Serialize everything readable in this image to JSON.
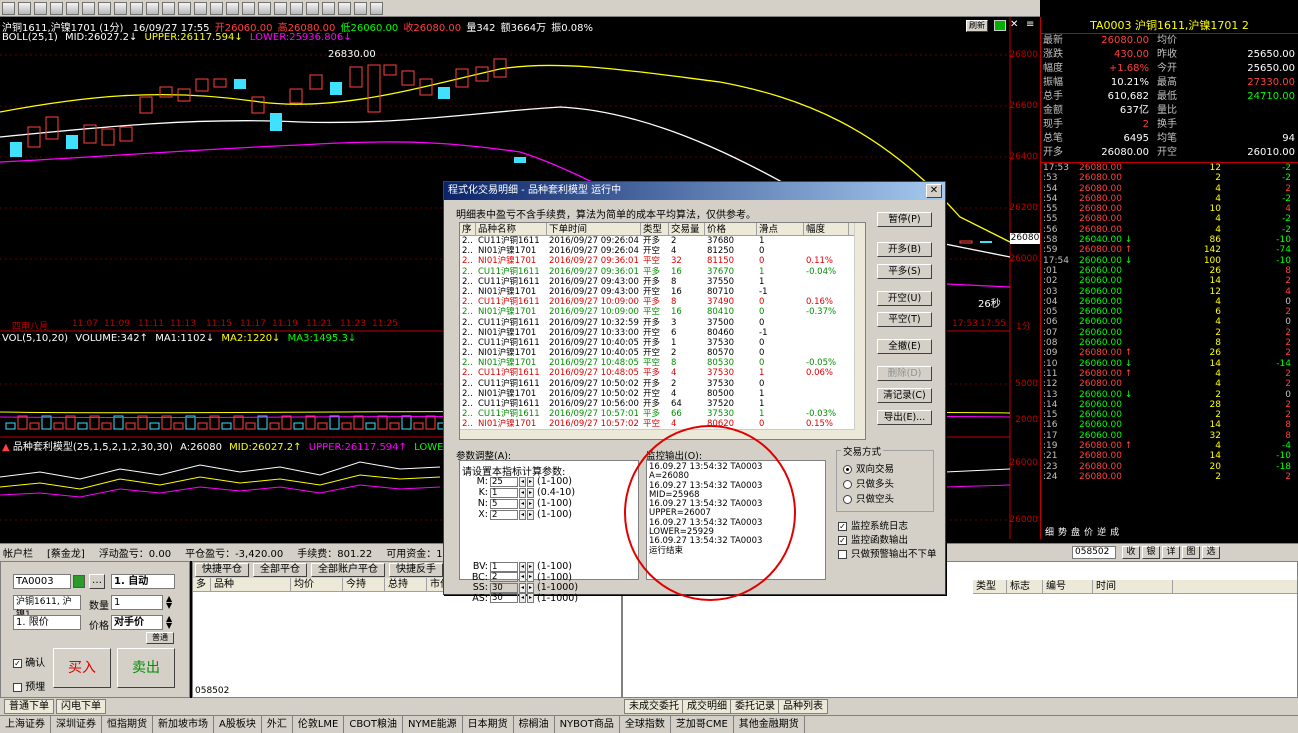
{
  "chart": {
    "header": [
      "沪铜1611,沪镍1701 (1分)",
      "16/09/27 17:55",
      "开26060.00",
      "高26080.00",
      "低26060.00",
      "收26080.00",
      "量342",
      "额3664万",
      "振0.08%"
    ],
    "boll": {
      "label": "BOLL(25,1)",
      "mid": "MID:26027.2↓",
      "upper": "UPPER:26117.594↓",
      "lower": "LOWER:25936.806↓"
    },
    "peak_label": "26830.00",
    "refresh_btn": "刷新",
    "axis_right": [
      "26800",
      "26600",
      "26400",
      "26200",
      "26000"
    ],
    "price_tag": "26080",
    "countdown": "26秒",
    "time_axis": [
      "四审八月",
      "11:07",
      "11:09",
      "11:11",
      "11:13",
      "11:15",
      "11:17",
      "11:19",
      "11:21",
      "11:23",
      "11:25",
      "17:53",
      "17:55",
      "1分"
    ],
    "vol": {
      "label": "VOL(5,10,20)",
      "volume": "VOLUME:342↑",
      "ma1": "MA1:1102↓",
      "ma2": "MA2:1220↓",
      "ma3": "MA3:1495.3↓"
    },
    "vol_axis": [
      "5000",
      "2000"
    ],
    "model": {
      "label": "品种套利模型(25,1,5,2,1,2,30,30)",
      "a": "A:26080",
      "mid": "MID:26027.2↑",
      "upper": "UPPER:26117.594↑",
      "lower": "LOWER:25936.806↑"
    },
    "model_axis": [
      "26000",
      "26000"
    ]
  },
  "quote": {
    "title": "TA0003  沪铜1611,沪镍1701  2",
    "rows": [
      {
        "l": "最新",
        "v": "26080.00",
        "vc": "#ff4040",
        "l2": "均价",
        "v2": "",
        "v2c": "#c0c0c0"
      },
      {
        "l": "涨跌",
        "v": "430.00",
        "vc": "#ff4040",
        "l2": "昨收",
        "v2": "25650.00",
        "v2c": "#ffffff"
      },
      {
        "l": "幅度",
        "v": "+1.68%",
        "vc": "#ff4040",
        "l2": "今开",
        "v2": "25650.00",
        "v2c": "#ffffff"
      },
      {
        "l": "振幅",
        "v": "10.21%",
        "vc": "#ffffff",
        "l2": "最高",
        "v2": "27330.00",
        "v2c": "#ff4040"
      },
      {
        "l": "总手",
        "v": "610,682",
        "vc": "#ffffff",
        "l2": "最低",
        "v2": "24710.00",
        "v2c": "#00ff00"
      },
      {
        "l": "金额",
        "v": "637亿",
        "vc": "#ffffff",
        "l2": "量比",
        "v2": "",
        "v2c": "#c0c0c0"
      },
      {
        "l": "现手",
        "v": "2",
        "vc": "#ff4040",
        "l2": "换手",
        "v2": "",
        "v2c": "#c0c0c0"
      },
      {
        "l": "总笔",
        "v": "6495",
        "vc": "#ffffff",
        "l2": "均笔",
        "v2": "94",
        "v2c": "#ffffff"
      },
      {
        "l": "开多",
        "v": "26080.00",
        "vc": "#ffffff",
        "l2": "开空",
        "v2": "26010.00",
        "v2c": "#ffffff"
      }
    ],
    "ticks": [
      {
        "t": "17:53",
        "p": "26080.00",
        "vol": "12",
        "chg": "-2",
        "vc": "#ff4040",
        "cc": "#00ff00"
      },
      {
        "t": ":53",
        "p": "26080.00",
        "vol": "2",
        "chg": "-2",
        "vc": "#ff4040",
        "cc": "#00ff00"
      },
      {
        "t": ":54",
        "p": "26080.00",
        "vol": "4",
        "chg": "2",
        "vc": "#ff4040",
        "cc": "#ff4040"
      },
      {
        "t": ":54",
        "p": "26080.00",
        "vol": "4",
        "chg": "-2",
        "vc": "#ff4040",
        "cc": "#00ff00"
      },
      {
        "t": ":55",
        "p": "26080.00",
        "vol": "10",
        "chg": "4",
        "vc": "#ff4040",
        "cc": "#ff4040"
      },
      {
        "t": ":55",
        "p": "26080.00",
        "vol": "4",
        "chg": "-2",
        "vc": "#ff4040",
        "cc": "#00ff00"
      },
      {
        "t": ":56",
        "p": "26080.00",
        "vol": "4",
        "chg": "-2",
        "vc": "#ff4040",
        "cc": "#00ff00"
      },
      {
        "t": ":58",
        "p": "26040.00 ↓",
        "vol": "86",
        "chg": "-10",
        "vc": "#00ff00",
        "cc": "#00ff00"
      },
      {
        "t": ":59",
        "p": "26080.00 ↑",
        "vol": "142",
        "chg": "-74",
        "vc": "#ff4040",
        "cc": "#00ff00"
      },
      {
        "t": "17:54",
        "p": "26060.00 ↓",
        "vol": "100",
        "chg": "-10",
        "vc": "#00ff00",
        "cc": "#00ff00"
      },
      {
        "t": ":01",
        "p": "26060.00",
        "vol": "26",
        "chg": "8",
        "vc": "#00ff00",
        "cc": "#ff4040"
      },
      {
        "t": ":02",
        "p": "26060.00",
        "vol": "14",
        "chg": "2",
        "vc": "#00ff00",
        "cc": "#ff4040"
      },
      {
        "t": ":03",
        "p": "26060.00",
        "vol": "12",
        "chg": "4",
        "vc": "#00ff00",
        "cc": "#ff4040"
      },
      {
        "t": ":04",
        "p": "26060.00",
        "vol": "4",
        "chg": "0",
        "vc": "#00ff00",
        "cc": "#c0c0c0"
      },
      {
        "t": ":05",
        "p": "26060.00",
        "vol": "6",
        "chg": "2",
        "vc": "#00ff00",
        "cc": "#ff4040"
      },
      {
        "t": ":06",
        "p": "26060.00",
        "vol": "4",
        "chg": "0",
        "vc": "#00ff00",
        "cc": "#c0c0c0"
      },
      {
        "t": ":07",
        "p": "26060.00",
        "vol": "2",
        "chg": "2",
        "vc": "#00ff00",
        "cc": "#ff4040"
      },
      {
        "t": ":08",
        "p": "26060.00",
        "vol": "8",
        "chg": "2",
        "vc": "#00ff00",
        "cc": "#ff4040"
      },
      {
        "t": ":09",
        "p": "26080.00 ↑",
        "vol": "26",
        "chg": "2",
        "vc": "#ff4040",
        "cc": "#ff4040"
      },
      {
        "t": ":10",
        "p": "26060.00 ↓",
        "vol": "14",
        "chg": "-14",
        "vc": "#00ff00",
        "cc": "#00ff00"
      },
      {
        "t": ":11",
        "p": "26080.00 ↑",
        "vol": "4",
        "chg": "2",
        "vc": "#ff4040",
        "cc": "#ff4040"
      },
      {
        "t": ":12",
        "p": "26080.00",
        "vol": "4",
        "chg": "2",
        "vc": "#ff4040",
        "cc": "#ff4040"
      },
      {
        "t": ":13",
        "p": "26060.00 ↓",
        "vol": "2",
        "chg": "0",
        "vc": "#00ff00",
        "cc": "#c0c0c0"
      },
      {
        "t": ":14",
        "p": "26060.00",
        "vol": "28",
        "chg": "2",
        "vc": "#00ff00",
        "cc": "#ff4040"
      },
      {
        "t": ":15",
        "p": "26060.00",
        "vol": "2",
        "chg": "2",
        "vc": "#00ff00",
        "cc": "#ff4040"
      },
      {
        "t": ":16",
        "p": "26060.00",
        "vol": "14",
        "chg": "8",
        "vc": "#00ff00",
        "cc": "#ff4040"
      },
      {
        "t": ":17",
        "p": "26060.00",
        "vol": "32",
        "chg": "8",
        "vc": "#00ff00",
        "cc": "#ff4040"
      },
      {
        "t": ":19",
        "p": "26080.00 ↑",
        "vol": "4",
        "chg": "-4",
        "vc": "#ff4040",
        "cc": "#00ff00"
      },
      {
        "t": ":21",
        "p": "26080.00",
        "vol": "14",
        "chg": "-10",
        "vc": "#ff4040",
        "cc": "#00ff00"
      },
      {
        "t": ":23",
        "p": "26080.00",
        "vol": "20",
        "chg": "-18",
        "vc": "#ff4040",
        "cc": "#00ff00"
      },
      {
        "t": ":24",
        "p": "26080.00",
        "vol": "2",
        "chg": "2",
        "vc": "#ff4040",
        "cc": "#ff4040"
      }
    ],
    "tabs": [
      "细",
      "势",
      "盘",
      "价",
      "逆",
      "成"
    ]
  },
  "account": {
    "label": "帐户栏",
    "name": "[蔡金龙]",
    "float_pnl": "浮动盈亏：0.00",
    "close_pnl": "平仓盈亏：-3,420.00",
    "fee": "手续费：801.22",
    "available": "可用资金：1,110,091.73",
    "account_id": "058502",
    "right_btns": [
      "收",
      "银",
      "详",
      "图",
      "选"
    ]
  },
  "order": {
    "code": "TA0003",
    "mode": "1. 自动",
    "name": "沪铜1611, 沪镍1",
    "qty_label": "数量",
    "qty": "1",
    "price_type": "1. 限价",
    "price_label": "价格",
    "price": "对手价",
    "refresh": "普通",
    "confirm_label": "确认",
    "preorder_label": "预埋",
    "buy_label": "买入",
    "sell_label": "卖出"
  },
  "positions": {
    "buttons": [
      "快捷平仓",
      "全部平仓",
      "全部账户平仓",
      "快捷反手"
    ],
    "columns": [
      "多",
      "品种",
      "均价",
      "今持",
      "总持",
      "市价"
    ],
    "footer": "058502"
  },
  "deals": {
    "columns": [
      "类型",
      "标志",
      "编号",
      "时间"
    ]
  },
  "bottom_tabs_left": [
    "普通下单",
    "闪电下单"
  ],
  "bottom_tabs_right": [
    "未成交委托",
    "成交明细",
    "委托记录",
    "品种列表"
  ],
  "markets": [
    "上海证券",
    "深圳证券",
    "恒指期货",
    "新加坡市场",
    "A股板块",
    "外汇",
    "伦敦LME",
    "CBOT粮油",
    "NYME能源",
    "日本期货",
    "棕榈油",
    "NYBOT商品",
    "全球指数",
    "芝加哥CME",
    "其他金融期货"
  ],
  "dialog": {
    "title": "程式化交易明细 - 品种套利模型 运行中",
    "note": "明细表中盈亏不含手续费，算法为简单的成本平均算法，仅供参考。",
    "columns": [
      "序",
      "品种名称",
      "下单时间",
      "类型",
      "交易量",
      "价格",
      "滑点",
      "幅度"
    ],
    "rows": [
      {
        "c": "r-black",
        "v": [
          "2..",
          "CU11沪铜1611",
          "2016/09/27 09:26:04",
          "开多",
          "2",
          "37680",
          "1",
          ""
        ]
      },
      {
        "c": "r-black",
        "v": [
          "2..",
          "NI01沪镍1701",
          "2016/09/27 09:26:04",
          "开空",
          "4",
          "81250",
          "0",
          ""
        ]
      },
      {
        "c": "r-red",
        "v": [
          "2..",
          "NI01沪镍1701",
          "2016/09/27 09:36:01",
          "平空",
          "32",
          "81150",
          "0",
          "0.11%"
        ]
      },
      {
        "c": "r-green",
        "v": [
          "2..",
          "CU11沪铜1611",
          "2016/09/27 09:36:01",
          "平多",
          "16",
          "37670",
          "1",
          "-0.04%"
        ]
      },
      {
        "c": "r-black",
        "v": [
          "2..",
          "CU11沪铜1611",
          "2016/09/27 09:43:00",
          "开多",
          "8",
          "37550",
          "1",
          ""
        ]
      },
      {
        "c": "r-black",
        "v": [
          "2..",
          "NI01沪镍1701",
          "2016/09/27 09:43:00",
          "开空",
          "16",
          "80710",
          "-1",
          ""
        ]
      },
      {
        "c": "r-red",
        "v": [
          "2..",
          "CU11沪铜1611",
          "2016/09/27 10:09:00",
          "平多",
          "8",
          "37490",
          "0",
          "0.16%"
        ]
      },
      {
        "c": "r-green",
        "v": [
          "2..",
          "NI01沪镍1701",
          "2016/09/27 10:09:00",
          "平空",
          "16",
          "80410",
          "0",
          "-0.37%"
        ]
      },
      {
        "c": "r-black",
        "v": [
          "2..",
          "CU11沪铜1611",
          "2016/09/27 10:32:59",
          "开多",
          "3",
          "37500",
          "0",
          ""
        ]
      },
      {
        "c": "r-black",
        "v": [
          "2..",
          "NI01沪镍1701",
          "2016/09/27 10:33:00",
          "开空",
          "6",
          "80460",
          "-1",
          ""
        ]
      },
      {
        "c": "r-black",
        "v": [
          "2..",
          "CU11沪铜1611",
          "2016/09/27 10:40:05",
          "开多",
          "1",
          "37530",
          "0",
          ""
        ]
      },
      {
        "c": "r-black",
        "v": [
          "2..",
          "NI01沪镍1701",
          "2016/09/27 10:40:05",
          "开空",
          "2",
          "80570",
          "0",
          ""
        ]
      },
      {
        "c": "r-green",
        "v": [
          "2..",
          "NI01沪镍1701",
          "2016/09/27 10:48:05",
          "平空",
          "8",
          "80530",
          "0",
          "-0.05%"
        ]
      },
      {
        "c": "r-red",
        "v": [
          "2..",
          "CU11沪铜1611",
          "2016/09/27 10:48:05",
          "平多",
          "4",
          "37530",
          "1",
          "0.06%"
        ]
      },
      {
        "c": "r-black",
        "v": [
          "2..",
          "CU11沪铜1611",
          "2016/09/27 10:50:02",
          "开多",
          "2",
          "37530",
          "0",
          ""
        ]
      },
      {
        "c": "r-black",
        "v": [
          "2..",
          "NI01沪镍1701",
          "2016/09/27 10:50:02",
          "开空",
          "4",
          "80500",
          "1",
          ""
        ]
      },
      {
        "c": "r-black",
        "v": [
          "2..",
          "CU11沪铜1611",
          "2016/09/27 10:56:00",
          "开多",
          "64",
          "37520",
          "1",
          ""
        ]
      },
      {
        "c": "r-green",
        "v": [
          "2..",
          "CU11沪铜1611",
          "2016/09/27 10:57:01",
          "平多",
          "66",
          "37530",
          "1",
          "-0.03%"
        ]
      },
      {
        "c": "r-red",
        "v": [
          "2..",
          "NI01沪镍1701",
          "2016/09/27 10:57:02",
          "平空",
          "4",
          "80620",
          "0",
          "0.15%"
        ]
      }
    ],
    "buttons": [
      "暂停(P)",
      "开多(B)",
      "平多(S)",
      "开空(U)",
      "平空(T)",
      "全撤(E)",
      "删除(D)",
      "清记录(C)",
      "导出(E)..."
    ],
    "param_title": "参数调整(A):",
    "param_heading": "请设置本指标计算参数:",
    "params": [
      {
        "k": "M:",
        "v": "25",
        "r": "(1-100)"
      },
      {
        "k": "K:",
        "v": "1",
        "r": "(0.4-10)"
      },
      {
        "k": "N:",
        "v": "5",
        "r": "(1-100)"
      },
      {
        "k": "X:",
        "v": "2",
        "r": "(1-100)"
      },
      {
        "k": "BV:",
        "v": "1",
        "r": "(1-100)"
      },
      {
        "k": "BC:",
        "v": "2",
        "r": "(1-100)"
      },
      {
        "k": "SS:",
        "v": "30",
        "r": "(1-1000)"
      },
      {
        "k": "AS:",
        "v": "30",
        "r": "(1-1000)"
      }
    ],
    "monitor_title": "监控输出(O):",
    "monitor_lines": [
      "16.09.27 13:54:32 TA0003",
      "A=26080",
      "16.09.27 13:54:32 TA0003",
      "MID=25968",
      "16.09.27 13:54:32 TA0003",
      "UPPER=26007",
      "16.09.27 13:54:32 TA0003",
      "LOWER=25929",
      "16.09.27 13:54:32 TA0003",
      "运行结束"
    ],
    "trade_mode_title": "交易方式",
    "trade_modes": [
      "双向交易",
      "只做多头",
      "只做空头"
    ],
    "checks": [
      "监控系统日志",
      "监控函数输出",
      "只做预警输出不下单"
    ]
  }
}
